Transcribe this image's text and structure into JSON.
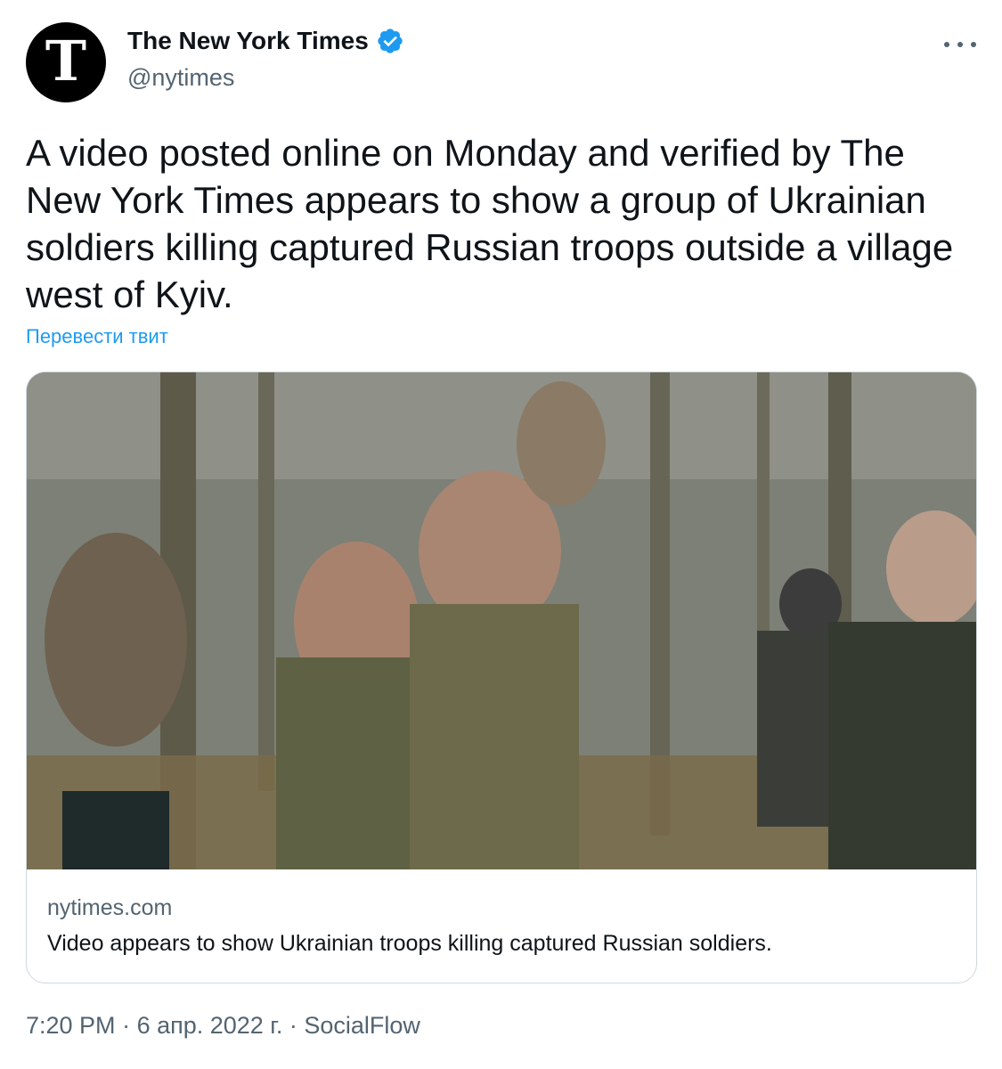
{
  "author": {
    "name": "The New York Times",
    "handle": "@nytimes",
    "avatar_glyph": "T",
    "verified_icon": "verified-badge-icon"
  },
  "tweet": {
    "text": "A video posted online on Monday and verified by The New York Times appears to show a group of Ukrainian soldiers killing captured Russian troops outside a village west of Kyiv.",
    "translate_label": "Перевести твит"
  },
  "card": {
    "domain": "nytimes.com",
    "title": "Video appears to show Ukrainian troops killing captured Russian soldiers."
  },
  "meta": {
    "time": "7:20 PM",
    "separator": " · ",
    "date": "6 апр. 2022 г.",
    "source": "SocialFlow"
  },
  "colors": {
    "text_primary": "#0f1419",
    "text_secondary": "#536471",
    "link": "#1d9bf0",
    "verified": "#1d9bf0",
    "border": "#cfd9de"
  }
}
